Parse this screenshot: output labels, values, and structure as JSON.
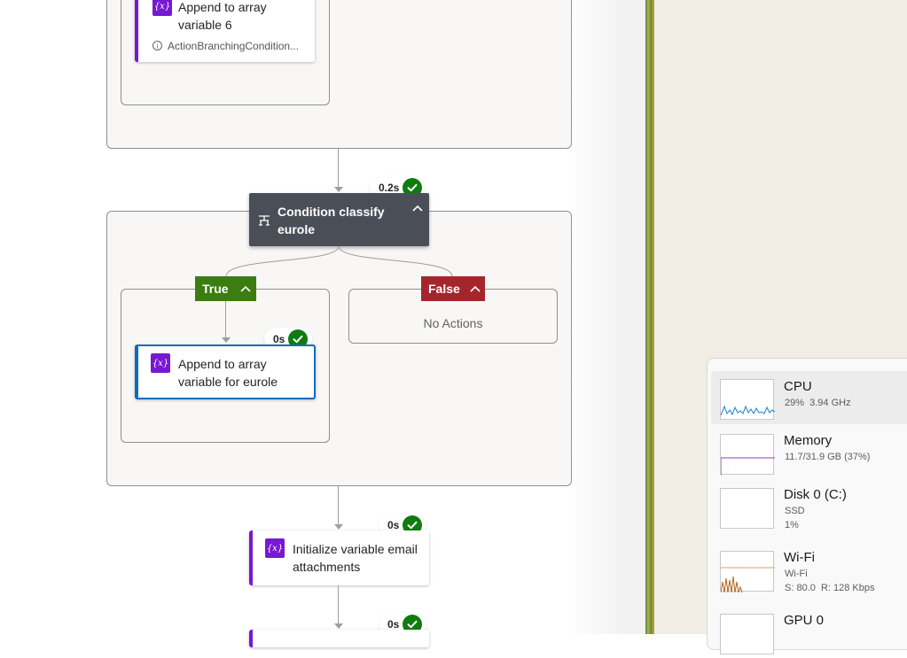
{
  "flow": {
    "top_card": {
      "title": "Append to array variable 6",
      "subtitle": "ActionBranchingCondition..."
    },
    "condition": {
      "duration": "0.2s",
      "title": "Condition classify eurole",
      "true_label": "True",
      "false_label": "False",
      "false_empty": "No Actions",
      "true_action": {
        "duration": "0s",
        "title": "Append to array variable for eurole"
      }
    },
    "init_var": {
      "duration": "0s",
      "title": "Initialize variable email attachments"
    },
    "next_action": {
      "duration": "0s"
    }
  },
  "task_manager": {
    "items": [
      {
        "name": "CPU",
        "details": [
          "29%  3.94 GHz"
        ]
      },
      {
        "name": "Memory",
        "details": [
          "11.7/31.9 GB (37%)"
        ]
      },
      {
        "name": "Disk 0 (C:)",
        "details": [
          "SSD",
          "1%"
        ]
      },
      {
        "name": "Wi-Fi",
        "details": [
          "Wi-Fi",
          "S: 80.0  R: 128 Kbps"
        ]
      },
      {
        "name": "GPU 0",
        "details": []
      }
    ]
  },
  "colors": {
    "action_purple": "#7719d1",
    "true_green": "#3b7d10",
    "false_red": "#a4262c",
    "success_green": "#107c10",
    "selected_blue": "#0f6cbd",
    "condition_header": "#4a4f57"
  }
}
